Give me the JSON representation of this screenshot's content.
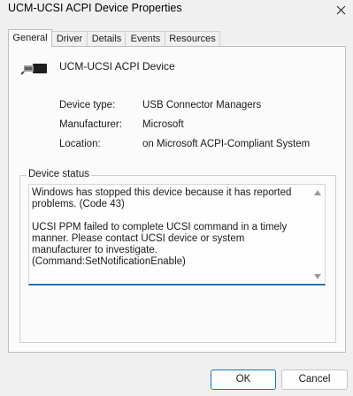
{
  "window": {
    "title": "UCM-UCSI ACPI Device Properties"
  },
  "tabs": [
    {
      "label": "General"
    },
    {
      "label": "Driver"
    },
    {
      "label": "Details"
    },
    {
      "label": "Events"
    },
    {
      "label": "Resources"
    }
  ],
  "device": {
    "name": "UCM-UCSI ACPI Device",
    "icon": "usb-connector-icon"
  },
  "properties": {
    "type_label": "Device type:",
    "type_value": "USB Connector Managers",
    "manufacturer_label": "Manufacturer:",
    "manufacturer_value": "Microsoft",
    "location_label": "Location:",
    "location_value": "on Microsoft ACPI-Compliant System"
  },
  "status": {
    "legend": "Device status",
    "text": "Windows has stopped this device because it has reported problems. (Code 43)\n\nUCSI PPM failed to complete UCSI command in a timely manner. Please contact UCSI device or system manufacturer to investigate. (Command:SetNotificationEnable)"
  },
  "buttons": {
    "ok": "OK",
    "cancel": "Cancel"
  }
}
